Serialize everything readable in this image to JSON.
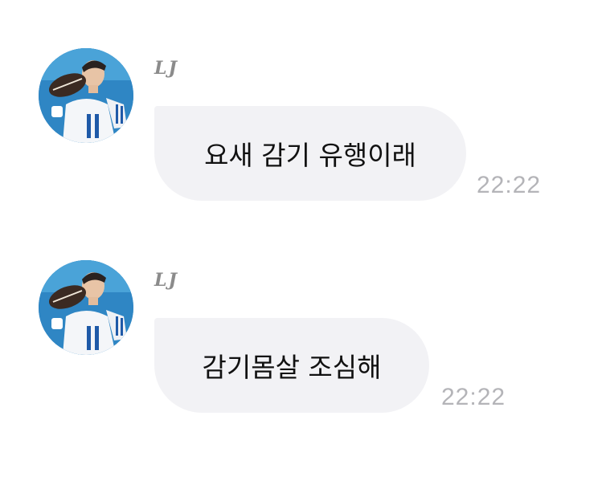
{
  "messages": [
    {
      "sender": "LJ",
      "text": "요새 감기 유행이래",
      "time": "22:22",
      "avatar_icon": "profile-photo-football-player"
    },
    {
      "sender": "LJ",
      "text": "감기몸살 조심해",
      "time": "22:22",
      "avatar_icon": "profile-photo-football-player"
    }
  ],
  "colors": {
    "bubble_bg": "#f2f2f5",
    "timestamp": "#b4b4b8",
    "sender_name": "#8b8b8b",
    "avatar_bg": "#2f86c4"
  }
}
